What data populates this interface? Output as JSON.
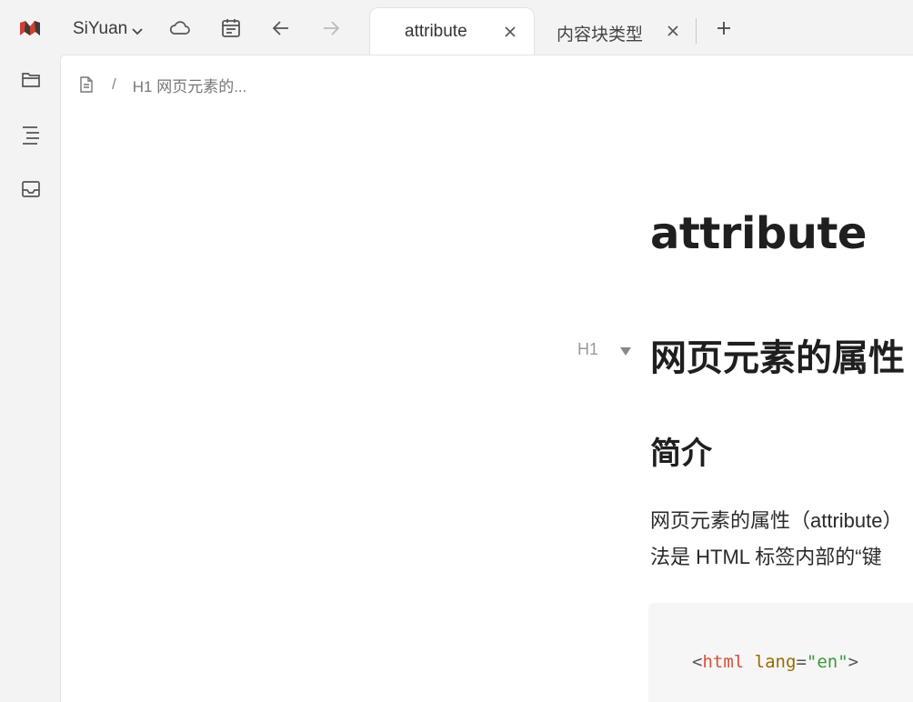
{
  "app": {
    "workspace_name": "SiYuan",
    "accent_color": "#d23f31"
  },
  "toolbar": {
    "icons": [
      "siyuan-logo",
      "chevron-down-icon",
      "cloud-icon",
      "calendar-icon",
      "arrow-left-icon",
      "arrow-right-icon",
      "plus-icon"
    ]
  },
  "tabs": [
    {
      "label": "attribute",
      "active": true
    },
    {
      "label": "内容块类型",
      "active": false
    }
  ],
  "dock": {
    "icons": [
      "folder-icon",
      "outline-icon",
      "inbox-icon"
    ]
  },
  "breadcrumb": {
    "separator": "/",
    "item": "H1 网页元素的..."
  },
  "document": {
    "title": "attribute",
    "gutter_label": "H1",
    "heading1": "网页元素的属性",
    "heading2": "简介",
    "paragraph_line1": "网页元素的属性（attribute）",
    "paragraph_line2": "法是 HTML 标签内部的“键"
  },
  "code": {
    "open": "<",
    "tag": "html",
    "space": " ",
    "attr": "lang",
    "eq": "=",
    "value": "\"en\"",
    "close": ">"
  }
}
